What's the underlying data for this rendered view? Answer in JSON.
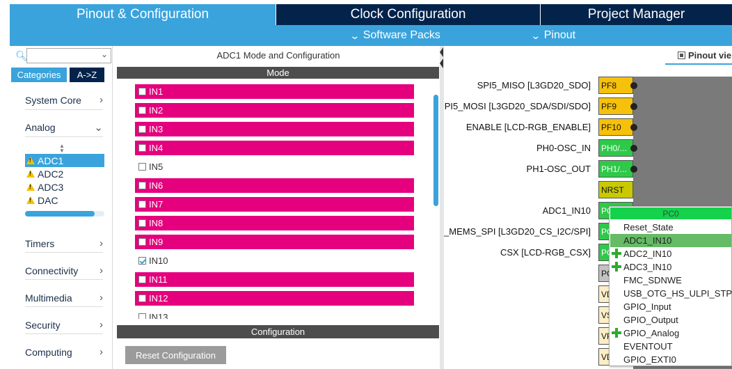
{
  "tabs": {
    "pinout_config": "Pinout & Configuration",
    "clock_config": "Clock Configuration",
    "project_manager": "Project Manager"
  },
  "subbar": {
    "software_packs": "Software Packs",
    "pinout": "Pinout"
  },
  "sidebar": {
    "search_value": "",
    "categories_label": "Categories",
    "az_label": "A->Z",
    "system_core": "System Core",
    "analog": "Analog",
    "analog_items": [
      "ADC1",
      "ADC2",
      "ADC3",
      "DAC"
    ],
    "selected_item": "ADC1",
    "timers": "Timers",
    "connectivity": "Connectivity",
    "multimedia": "Multimedia",
    "security": "Security",
    "computing": "Computing"
  },
  "mode_panel": {
    "title": "ADC1 Mode and Configuration",
    "mode_header": "Mode",
    "inputs": [
      {
        "label": "IN1",
        "enabled": true,
        "checked": false
      },
      {
        "label": "IN2",
        "enabled": true,
        "checked": false
      },
      {
        "label": "IN3",
        "enabled": true,
        "checked": false
      },
      {
        "label": "IN4",
        "enabled": true,
        "checked": false
      },
      {
        "label": "IN5",
        "enabled": false,
        "checked": false
      },
      {
        "label": "IN6",
        "enabled": true,
        "checked": false
      },
      {
        "label": "IN7",
        "enabled": true,
        "checked": false
      },
      {
        "label": "IN8",
        "enabled": true,
        "checked": false
      },
      {
        "label": "IN9",
        "enabled": true,
        "checked": false
      },
      {
        "label": "IN10",
        "enabled": false,
        "checked": true
      },
      {
        "label": "IN11",
        "enabled": true,
        "checked": false
      },
      {
        "label": "IN12",
        "enabled": true,
        "checked": false
      },
      {
        "label": "IN13",
        "enabled": false,
        "checked": false
      }
    ],
    "config_header": "Configuration",
    "reset_button": "Reset Configuration"
  },
  "pinout_view": {
    "label": "Pinout vie",
    "pins": [
      {
        "signal": "SPI5_MISO [L3GD20_SDO]",
        "pin": "PF8",
        "color": "yellow"
      },
      {
        "signal": "PI5_MOSI [L3GD20_SDA/SDI/SDO]",
        "pin": "PF9",
        "color": "yellow"
      },
      {
        "signal": "ENABLE [LCD-RGB_ENABLE]",
        "pin": "PF10",
        "color": "yellow"
      },
      {
        "signal": "PH0-OSC_IN",
        "pin": "PH0/...",
        "color": "green"
      },
      {
        "signal": "PH1-OSC_OUT",
        "pin": "PH1/...",
        "color": "green"
      },
      {
        "signal": "",
        "pin": "NRST",
        "color": "olive"
      },
      {
        "signal": "ADC1_IN10",
        "pin": "PC0",
        "color": "green"
      },
      {
        "signal": "_MEMS_SPI [L3GD20_CS_I2C/SPI]",
        "pin": "PC",
        "color": "green"
      },
      {
        "signal": "CSX [LCD-RGB_CSX]",
        "pin": "PC",
        "color": "green"
      },
      {
        "signal": "",
        "pin": "PC",
        "color": "grey"
      },
      {
        "signal": "",
        "pin": "VD",
        "color": "cream"
      },
      {
        "signal": "",
        "pin": "VS",
        "color": "cream"
      },
      {
        "signal": "",
        "pin": "VR",
        "color": "cream"
      },
      {
        "signal": "",
        "pin": "VD",
        "color": "cream"
      }
    ]
  },
  "context_menu": {
    "header": "PC0",
    "items": [
      {
        "label": "Reset_State",
        "highlight": false,
        "plus": false
      },
      {
        "label": "ADC1_IN10",
        "highlight": true,
        "plus": false
      },
      {
        "label": "ADC2_IN10",
        "highlight": false,
        "plus": true
      },
      {
        "label": "ADC3_IN10",
        "highlight": false,
        "plus": true
      },
      {
        "label": "FMC_SDNWE",
        "highlight": false,
        "plus": false
      },
      {
        "label": "USB_OTG_HS_ULPI_STP",
        "highlight": false,
        "plus": false
      },
      {
        "label": "GPIO_Input",
        "highlight": false,
        "plus": false
      },
      {
        "label": "GPIO_Output",
        "highlight": false,
        "plus": false
      },
      {
        "label": "GPIO_Analog",
        "highlight": false,
        "plus": true
      },
      {
        "label": "EVENTOUT",
        "highlight": false,
        "plus": false
      },
      {
        "label": "GPIO_EXTI0",
        "highlight": false,
        "plus": false
      }
    ]
  },
  "colors": {
    "accent": "#3aa3dc",
    "dark_navy": "#03234b",
    "mode_pink": "#e5007e",
    "pin_green": "#2fc94a",
    "pin_yellow": "#f6c10a"
  }
}
